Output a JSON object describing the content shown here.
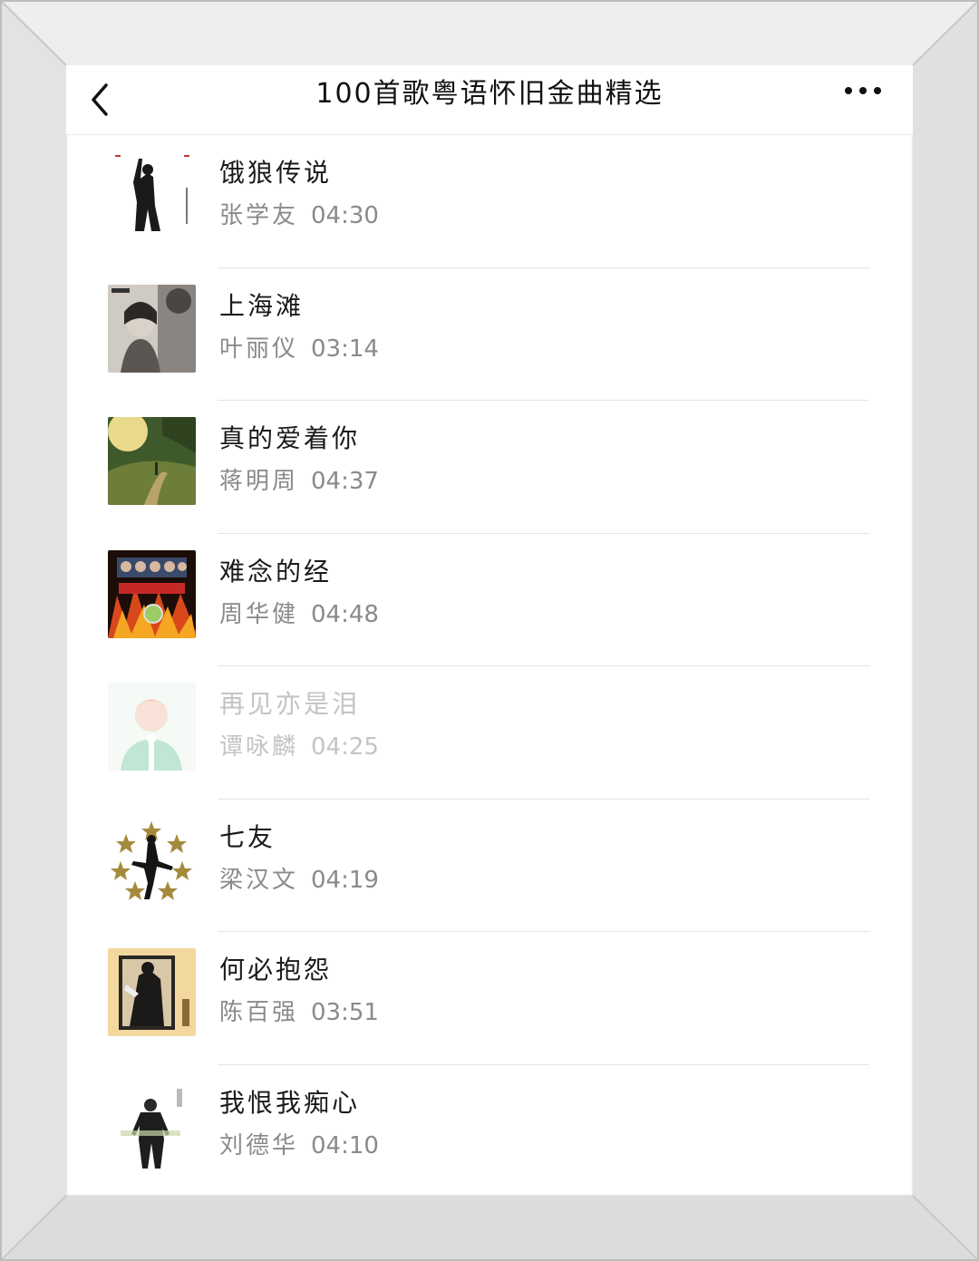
{
  "header": {
    "title": "100首歌粤语怀旧金曲精选",
    "back_icon": "chevron-left-icon",
    "more_icon": "more-horizontal-icon"
  },
  "songs": [
    {
      "title": "饿狼传说",
      "artist": "张学友",
      "duration": "04:30",
      "available": true
    },
    {
      "title": "上海滩",
      "artist": "叶丽仪",
      "duration": "03:14",
      "available": true
    },
    {
      "title": "真的爱着你",
      "artist": "蒋明周",
      "duration": "04:37",
      "available": true
    },
    {
      "title": "难念的经",
      "artist": "周华健",
      "duration": "04:48",
      "available": true
    },
    {
      "title": "再见亦是泪",
      "artist": "谭咏麟",
      "duration": "04:25",
      "available": false
    },
    {
      "title": "七友",
      "artist": "梁汉文",
      "duration": "04:19",
      "available": true
    },
    {
      "title": "何必抱怨",
      "artist": "陈百强",
      "duration": "03:51",
      "available": true
    },
    {
      "title": "我恨我痴心",
      "artist": "刘德华",
      "duration": "04:10",
      "available": true
    }
  ],
  "colors": {
    "frame": "#e6e6e6",
    "title_text": "#111111",
    "meta_text": "#8a8a8a",
    "disabled_text": "#c4c4c4",
    "divider": "#e4e4e4"
  }
}
